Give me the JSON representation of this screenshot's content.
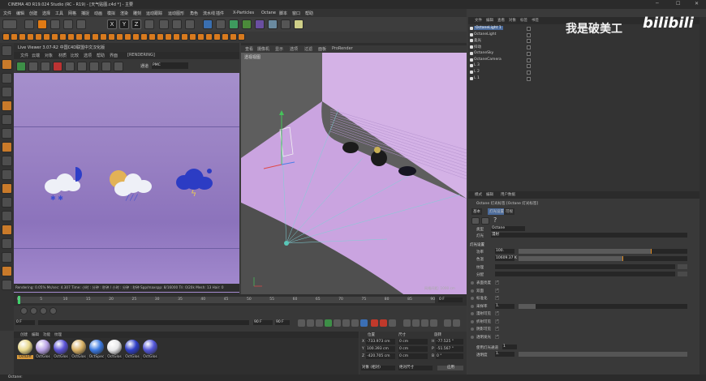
{
  "window": {
    "title": "CINEMA 4D R19.024 Studio (RC - R19) - [天气贴图.c4d *] - 主要"
  },
  "menu": [
    "文件",
    "编辑",
    "创建",
    "选择",
    "工具",
    "网格",
    "捕捉",
    "动画",
    "模拟",
    "渲染",
    "雕刻",
    "运动跟踪",
    "运动图形",
    "角色",
    "流水线",
    "插件",
    "X-Particles",
    "Octane",
    "脚本",
    "窗口",
    "帮助"
  ],
  "toolbar": {
    "axis_labels": [
      "X",
      "Y",
      "Z"
    ]
  },
  "live_viewer": {
    "title": "Live Viewer 3.07-R2 中国C4D联盟中文汉化版",
    "menu": [
      "文件",
      "云端",
      "对象",
      "材质",
      "比较",
      "选项",
      "帮助",
      "界面",
      "[RENDERING]"
    ],
    "mode_label": "通道",
    "mode_value": "PMC",
    "status_text": "Rendering: 0.05%  Ms/sec: 4.307  Time: 小时 : 分钟 : 秒钟 / 小时 : 分钟 : 秒钟  Spp/maxspp: 8/16000  Tri: 0/20k  Mesh: 13  Hair: 0"
  },
  "viewport": {
    "menu": [
      "查看",
      "摄像机",
      "显示",
      "选项",
      "过滤",
      "面板",
      "ProRender"
    ],
    "label": "透视视图",
    "grid_note": "网格间距: 1000 cm"
  },
  "timeline": {
    "frame_start": "0 F",
    "frame_end": "90 F",
    "frame_cur": "0 F",
    "frame_max": "90 F",
    "ticks": [
      "0",
      "5",
      "10",
      "15",
      "20",
      "25",
      "30",
      "35",
      "40",
      "45",
      "50",
      "55",
      "60",
      "65",
      "70",
      "75",
      "80",
      "85",
      "90"
    ]
  },
  "material_manager": {
    "menu": [
      "创建",
      "编辑",
      "功能",
      "纹理"
    ],
    "materials": [
      {
        "label": "OctDiff",
        "color": "#e8d88c",
        "selected": true
      },
      {
        "label": "OctGlos",
        "color": "#b9a2e6",
        "selected": false
      },
      {
        "label": "OctGlos",
        "color": "#5a52d6",
        "selected": false
      },
      {
        "label": "OctGlos",
        "color": "#d8b064",
        "selected": false
      },
      {
        "label": "OctSpec",
        "color": "#3a78e0",
        "selected": false
      },
      {
        "label": "OctGlos",
        "color": "#e8e8ea",
        "selected": false
      },
      {
        "label": "OctGlos",
        "color": "#2e3ec8",
        "selected": false
      },
      {
        "label": "OctGlos",
        "color": "#5256d8",
        "selected": false
      }
    ]
  },
  "coordinates": {
    "headers": [
      "位置",
      "尺寸",
      "旋转"
    ],
    "rows": [
      {
        "axis": "X",
        "pos": "-733.973 cm",
        "size": "0 cm",
        "rot_label": "H",
        "rot": "-77.525 °"
      },
      {
        "axis": "Y",
        "pos": "100.393 cm",
        "size": "0 cm",
        "rot_label": "P",
        "rot": "-51.567 °"
      },
      {
        "axis": "Z",
        "pos": "-420.705 cm",
        "size": "0 cm",
        "rot_label": "B",
        "rot": "0 °"
      }
    ],
    "mode": "对象 (相对)",
    "size_mode": "绝对尺寸",
    "apply": "应用"
  },
  "object_manager": {
    "menu": [
      "文件",
      "编辑",
      "查看",
      "对象",
      "标签",
      "书签"
    ],
    "objects": [
      {
        "name": "OctaneLight 1",
        "selected": true
      },
      {
        "name": "OctaneLight",
        "selected": false
      },
      {
        "name": "柔光",
        "selected": false
      },
      {
        "name": "抖动",
        "selected": false
      },
      {
        "name": "OctaneSky",
        "selected": false
      },
      {
        "name": "OctaneCamera",
        "selected": false
      },
      {
        "name": "L 3",
        "selected": false
      },
      {
        "name": "L 2",
        "selected": false
      },
      {
        "name": "L 1",
        "selected": false
      }
    ]
  },
  "attributes": {
    "menu": [
      "模式",
      "编辑",
      "用户数据"
    ],
    "header": "Octane 灯光标签 [Octane 灯光标签]",
    "tabs": [
      "基本",
      "灯光设置",
      "可视"
    ],
    "type_label": "类型",
    "type_value": "Octane",
    "cat_label": "灯光",
    "cat_value": "漫射",
    "section": "灯光设置",
    "power_label": "功率",
    "power_value": "100.",
    "power_fill": 0.79,
    "temp_label": "色温",
    "temp_value": "10609.37 K",
    "temp_fill": 0.62,
    "tex_label": "纹理",
    "dist_label": "分配",
    "rows": [
      {
        "label": "表面亮度",
        "checked": true
      },
      {
        "label": "双面",
        "checked": true
      },
      {
        "label": "标准化",
        "checked": true
      },
      {
        "label": "采样率",
        "value": "1.",
        "slider": true
      },
      {
        "label": "漫射可见",
        "checked": true
      },
      {
        "label": "折射可见",
        "checked": true
      },
      {
        "label": "阴影可见",
        "checked": true
      },
      {
        "label": "透明发光",
        "checked": true
      }
    ],
    "light_pass_label": "使用灯光通道",
    "light_pass_value": "1",
    "opacity_label": "透明度",
    "opacity_value": "1."
  },
  "status_bar": {
    "text": "Octane:"
  },
  "overlay": {
    "watermark": "我是破美工",
    "logo": "bilibili"
  },
  "colors": {
    "accent": "#e07a14",
    "render_bg": "#9a82c4",
    "selection": "#4a6a9a"
  }
}
